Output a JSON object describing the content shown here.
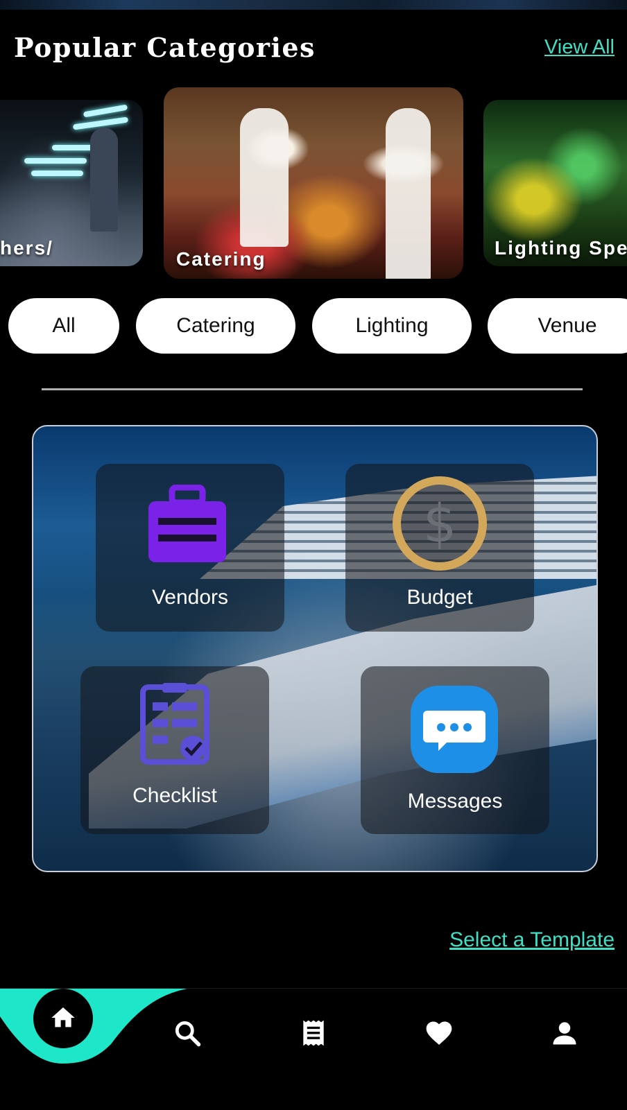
{
  "section": {
    "title": "Popular Categories",
    "view_all": "View All"
  },
  "categories": [
    {
      "label": "hers/"
    },
    {
      "label": "Catering"
    },
    {
      "label": "Lighting Spec"
    }
  ],
  "filters": [
    "All",
    "Catering",
    "Lighting",
    "Venue"
  ],
  "tiles": {
    "vendors": "Vendors",
    "budget": "Budget",
    "checklist": "Checklist",
    "messages": "Messages"
  },
  "select_template": "Select a Template",
  "nav": {
    "items": [
      "home-icon",
      "search-icon",
      "receipt-icon",
      "heart-icon",
      "person-icon"
    ],
    "active": "home-icon"
  },
  "colors": {
    "accent": "#3ee0c6",
    "vendors_icon": "#7a22e8",
    "budget_ring": "#d4a85a",
    "checklist_icon": "#5a4fd6",
    "messages_icon": "#1e8fe6"
  }
}
